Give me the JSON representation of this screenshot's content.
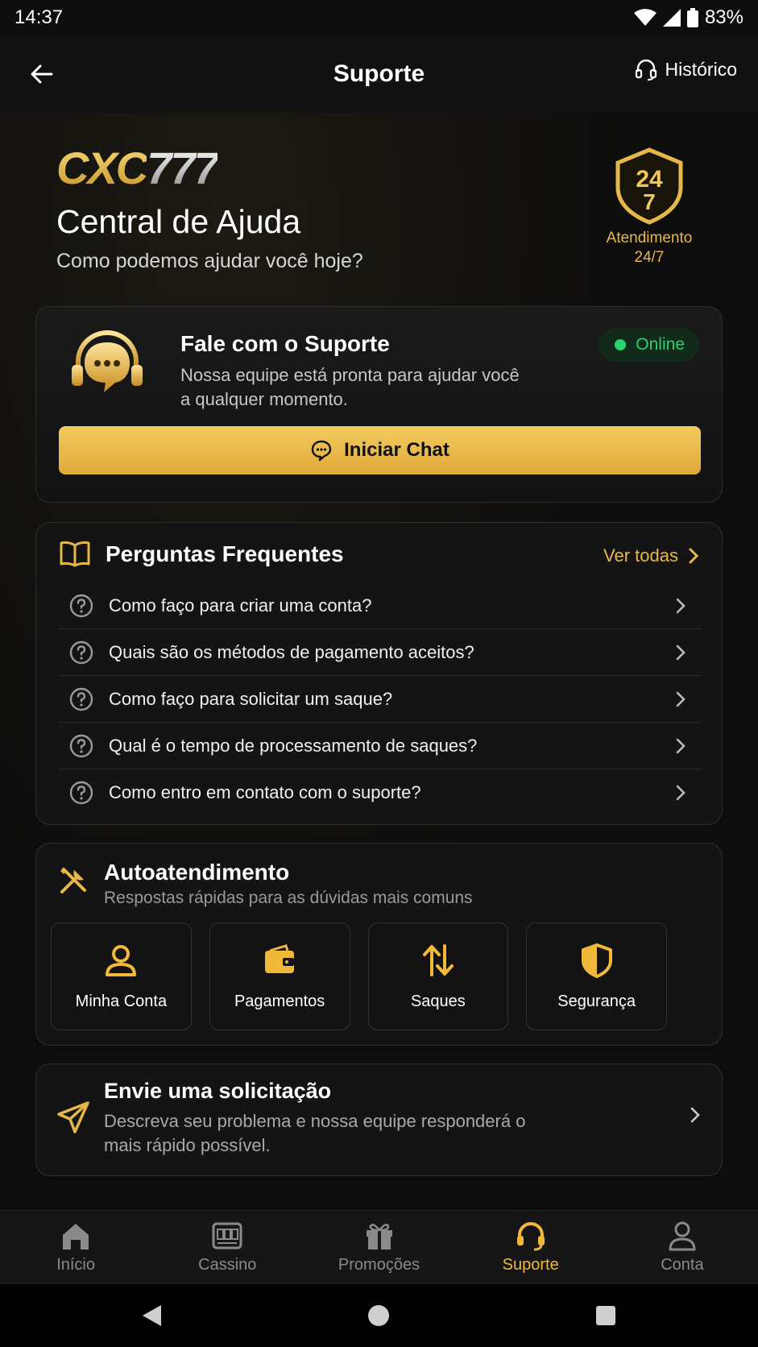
{
  "status_bar": {
    "time": "14:37",
    "battery": "83%"
  },
  "header": {
    "title": "Suporte",
    "history_label": "Histórico"
  },
  "hero": {
    "logo_gold": "CXC",
    "logo_silver": "777",
    "title": "Central de Ajuda",
    "subtitle": "Como podemos ajudar você hoje?",
    "badge_top": "24",
    "badge_bottom": "7",
    "badge_label_1": "Atendimento",
    "badge_label_2": "24/7"
  },
  "support_card": {
    "title": "Fale com o Suporte",
    "description": "Nossa equipe está pronta para ajudar você a qualquer momento.",
    "status": "Online",
    "status_color": "#27d36a",
    "button_label": "Iniciar Chat"
  },
  "faq": {
    "title": "Perguntas Frequentes",
    "see_all": "Ver todas",
    "items": [
      {
        "text": "Como faço para criar uma conta?"
      },
      {
        "text": "Quais são os métodos de pagamento aceitos?"
      },
      {
        "text": "Como faço para solicitar um saque?"
      },
      {
        "text": "Qual é o tempo de processamento de saques?"
      },
      {
        "text": "Como entro em contato com o suporte?"
      }
    ]
  },
  "self_service": {
    "title": "Autoatendimento",
    "subtitle": "Respostas rápidas para as dúvidas mais comuns",
    "tiles": [
      {
        "label": "Minha Conta",
        "icon": "user-icon"
      },
      {
        "label": "Pagamentos",
        "icon": "wallet-icon"
      },
      {
        "label": "Saques",
        "icon": "transfer-arrows-icon"
      },
      {
        "label": "Segurança",
        "icon": "shield-icon"
      }
    ]
  },
  "request": {
    "title": "Envie uma solicitação",
    "description": "Descreva seu problema e nossa equipe responderá o mais rápido possível."
  },
  "bottom_nav": {
    "items": [
      {
        "label": "Início",
        "icon": "home-icon"
      },
      {
        "label": "Cassino",
        "icon": "slot-machine-icon"
      },
      {
        "label": "Promoções",
        "icon": "gift-icon"
      },
      {
        "label": "Suporte",
        "icon": "headset-icon",
        "active": true
      },
      {
        "label": "Conta",
        "icon": "user-icon"
      }
    ]
  },
  "colors": {
    "accent": "#f0b93a",
    "background": "#0d0d0d",
    "card": "#141414"
  }
}
